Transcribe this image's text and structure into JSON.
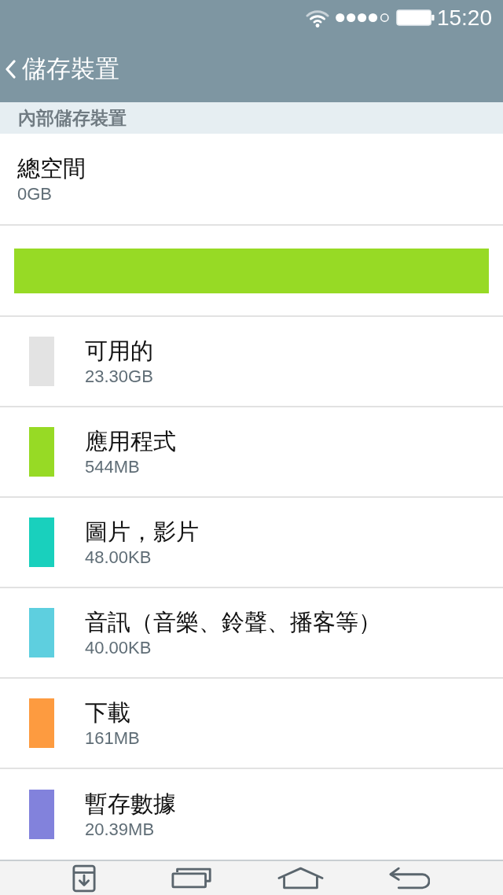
{
  "status_bar": {
    "time": "15:20"
  },
  "app_bar": {
    "title": "儲存裝置"
  },
  "section": {
    "title": "內部儲存裝置"
  },
  "total": {
    "label": "總空間",
    "value": "0GB"
  },
  "categories": [
    {
      "name": "可用的",
      "size": "23.30GB",
      "color": "#e3e3e3"
    },
    {
      "name": "應用程式",
      "size": "544MB",
      "color": "#97da25"
    },
    {
      "name": "圖片，影片",
      "size": "48.00KB",
      "color": "#19d0bd"
    },
    {
      "name": "音訊（音樂、鈴聲、播客等）",
      "size": "40.00KB",
      "color": "#5ecfdf"
    },
    {
      "name": "下載",
      "size": "161MB",
      "color": "#fd9b40"
    },
    {
      "name": "暫存數據",
      "size": "20.39MB",
      "color": "#8282dc"
    }
  ]
}
